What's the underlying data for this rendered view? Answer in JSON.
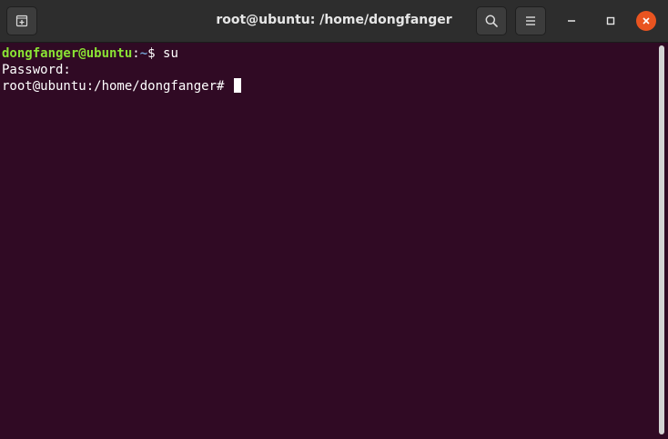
{
  "window": {
    "title": "root@ubuntu: /home/dongfanger"
  },
  "headerbar": {
    "new_tab_icon": "new-tab-icon",
    "search_icon": "search-icon",
    "menu_icon": "hamburger-menu-icon",
    "minimize_icon": "minimize-icon",
    "maximize_icon": "maximize-icon",
    "close_icon": "close-icon",
    "close_color": "#e95420"
  },
  "terminal": {
    "background": "#300a24",
    "line1": {
      "user_host": "dongfanger@ubuntu",
      "colon": ":",
      "path": "~",
      "prompt": "$ ",
      "command": "su"
    },
    "line2": {
      "text": "Password:"
    },
    "line3": {
      "prompt": "root@ubuntu:/home/dongfanger# "
    }
  }
}
